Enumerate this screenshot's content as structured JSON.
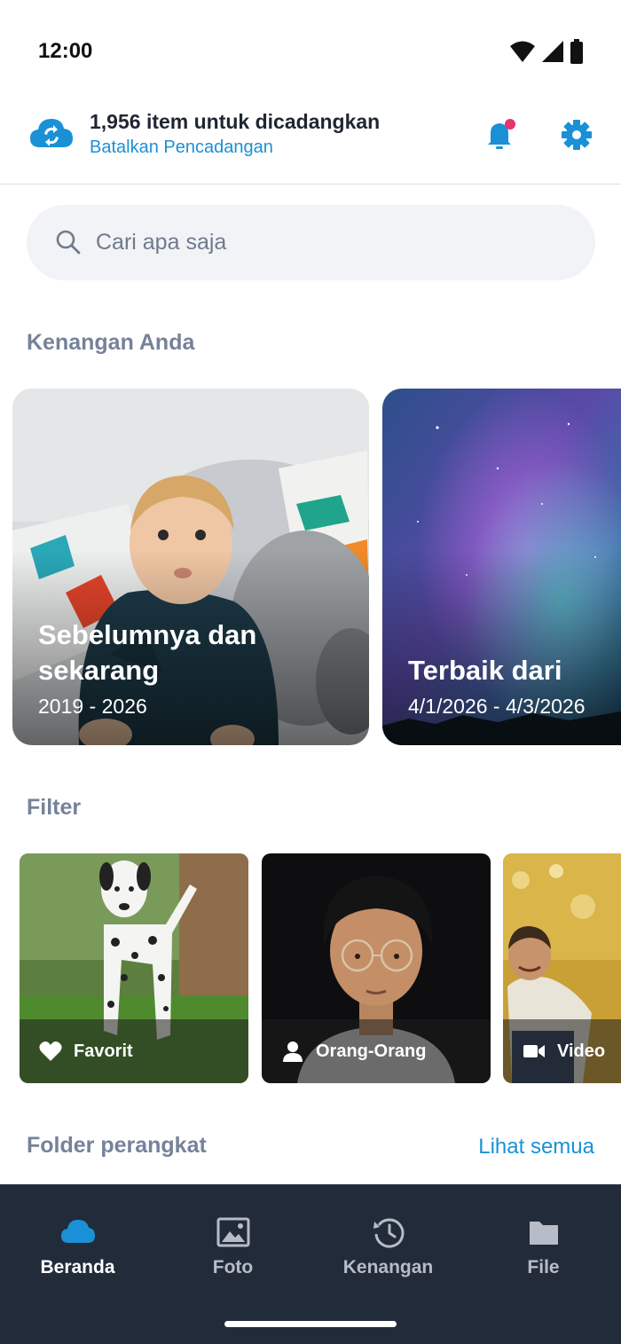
{
  "status_bar": {
    "time": "12:00",
    "icons": [
      "wifi-icon",
      "signal-icon",
      "battery-icon"
    ]
  },
  "header": {
    "backup_title": "1,956 item untuk dicadangkan",
    "backup_cancel": "Batalkan Pencadangan",
    "icons": [
      "cloud-sync-icon",
      "bell-icon",
      "gear-icon"
    ]
  },
  "search": {
    "placeholder": "Cari apa saja",
    "value": ""
  },
  "memories": {
    "title": "Kenangan Anda",
    "cards": [
      {
        "title": "Sebelumnya dan sekarang",
        "title_line1": "Sebelumnya dan",
        "title_line2": "sekarang",
        "date": "2019 - 2026"
      },
      {
        "title": "Terbaik dari",
        "date": "4/1/2026 - 4/3/2026"
      }
    ]
  },
  "filter": {
    "title": "Filter",
    "items": [
      {
        "label": "Favorit",
        "icon": "heart-icon"
      },
      {
        "label": "Orang-Orang",
        "icon": "person-icon"
      },
      {
        "label": "Video",
        "icon": "video-icon"
      }
    ]
  },
  "folders": {
    "title": "Folder perangkat",
    "see_all": "Lihat semua"
  },
  "bottom_nav": {
    "items": [
      {
        "label": "Beranda",
        "icon": "cloud-icon",
        "active": true
      },
      {
        "label": "Foto",
        "icon": "image-icon",
        "active": false
      },
      {
        "label": "Kenangan",
        "icon": "history-icon",
        "active": false
      },
      {
        "label": "File",
        "icon": "folder-icon",
        "active": false
      }
    ]
  },
  "colors": {
    "accent": "#1a91d6",
    "notification_dot": "#e8336d",
    "nav_background": "#222b3a",
    "section_title": "#76829a"
  }
}
